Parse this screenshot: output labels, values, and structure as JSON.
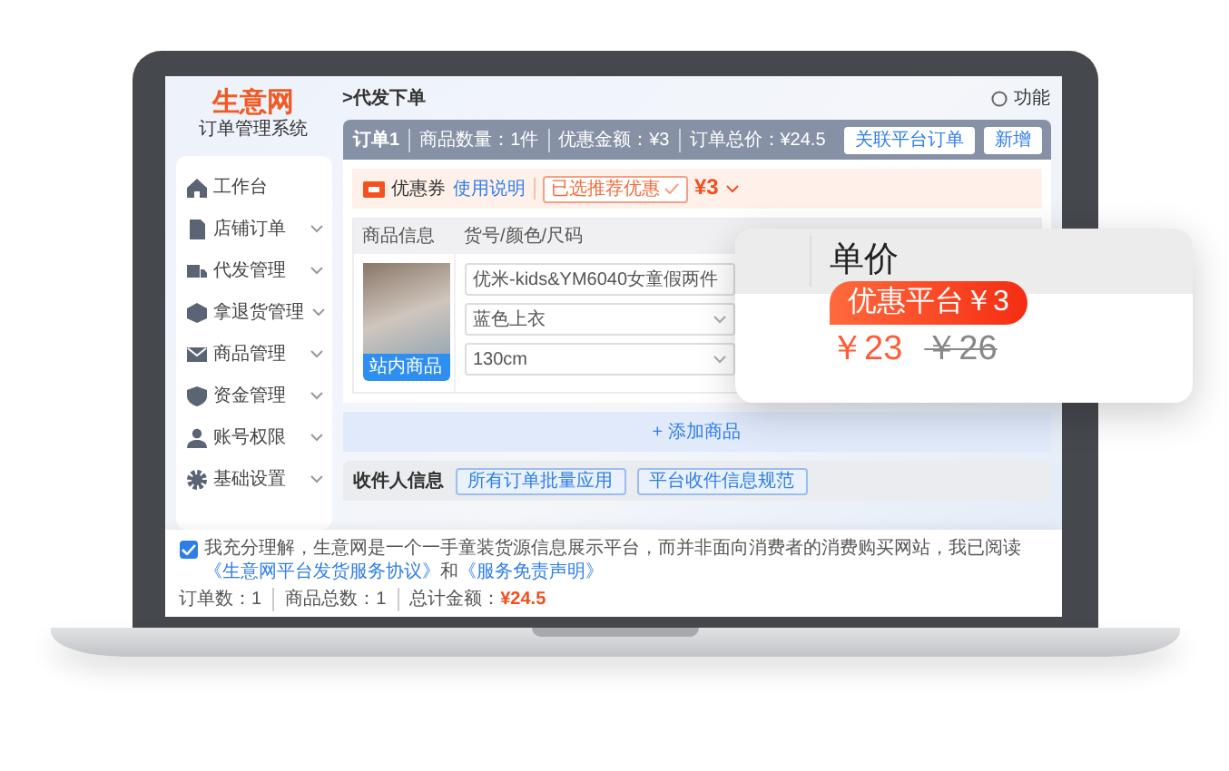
{
  "app": {
    "logo": "生意网",
    "subtitle": "订单管理系统",
    "top_right": "功能"
  },
  "sidebar": {
    "items": [
      {
        "label": "工作台",
        "expandable": false
      },
      {
        "label": "店铺订单",
        "expandable": true
      },
      {
        "label": "代发管理",
        "expandable": true
      },
      {
        "label": "拿退货管理",
        "expandable": true
      },
      {
        "label": "商品管理",
        "expandable": true
      },
      {
        "label": "资金管理",
        "expandable": true
      },
      {
        "label": "账号权限",
        "expandable": true
      },
      {
        "label": "基础设置",
        "expandable": true
      }
    ]
  },
  "breadcrumb": ">代发下单",
  "order_bar": {
    "title": "订单1",
    "stats": [
      "商品数量：1件",
      "优惠金额：¥3",
      "订单总价：¥24.5"
    ],
    "buttons": [
      "关联平台订单",
      "新增"
    ]
  },
  "coupon": {
    "label": "优惠券",
    "help_link": "使用说明",
    "selected_tag": "已选推荐优惠",
    "amount": "¥3"
  },
  "table": {
    "columns": [
      "商品信息",
      "货号/颜色/尺码"
    ],
    "rows": [
      {
        "source_button": "站内商品",
        "product": "优米-kids&YM6040女童假两件",
        "color_option": "蓝色上衣",
        "size": "130cm"
      }
    ]
  },
  "add_product": "+ 添加商品",
  "recipient": {
    "label": "收件人信息",
    "buttons": [
      "所有订单批量应用",
      "平台收件信息规范"
    ]
  },
  "agreement": {
    "checked": true,
    "text": "我充分理解，生意网是一个一手童装货源信息展示平台，而并非面向消费者的消费购买网站，我已阅读",
    "links": [
      "《生意网平台发货服务协议》",
      "《服务免责声明》"
    ],
    "joiner": "和"
  },
  "summary": [
    {
      "label": "订单数：",
      "value": "1",
      "highlight": false
    },
    {
      "label": "商品总数：",
      "value": "1",
      "highlight": false
    },
    {
      "label": "总计金额：",
      "value": "¥24.5",
      "highlight": true
    }
  ],
  "price_popup": {
    "column": "单价",
    "discount_badge": "优惠平台￥3",
    "price": "￥23",
    "original_price": "￥26"
  }
}
